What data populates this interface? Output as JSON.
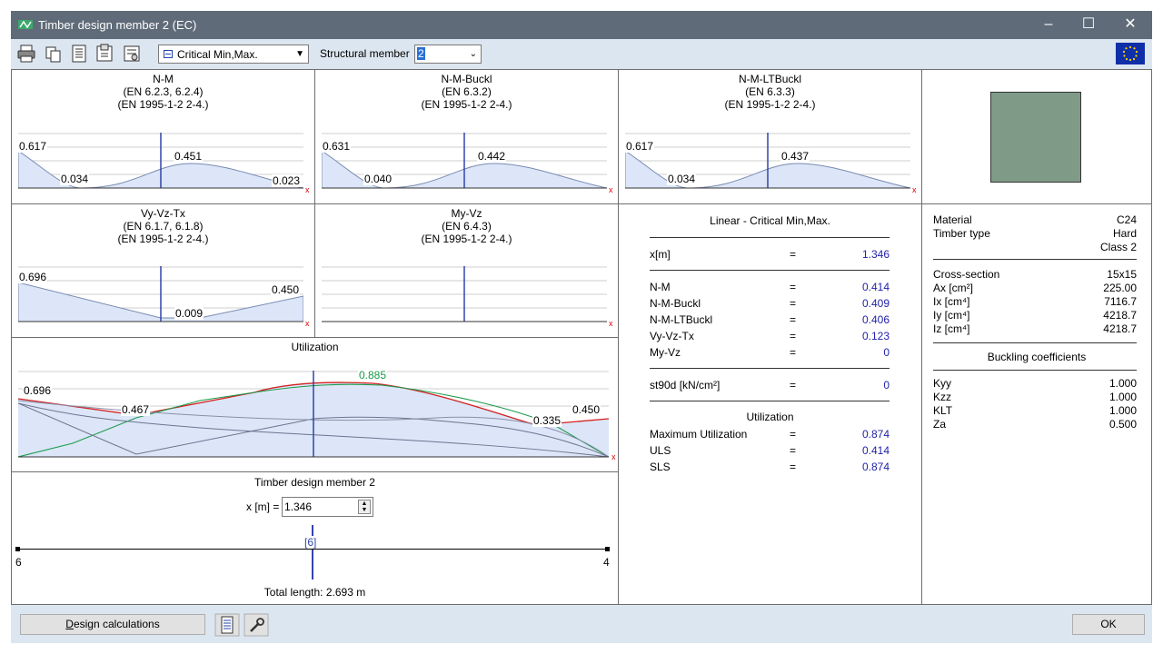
{
  "window": {
    "title": "Timber design member 2 (EC)",
    "controls": {
      "minimize": "–",
      "maximize": "☐",
      "close": "✕"
    }
  },
  "toolbar": {
    "icons": [
      "printer-icon",
      "copy-icon",
      "report-icon",
      "export-icon",
      "settings-icon"
    ],
    "mode_select": {
      "value": "Critical Min,Max."
    },
    "member_label": "Structural member",
    "member_select": {
      "value": "2"
    },
    "flag_icon": "eu-flag-icon"
  },
  "panels": {
    "nm": {
      "title": "N-M",
      "ref1": "(EN 6.2.3, 6.2.4)",
      "ref2": "(EN 1995-1-2 2-4.)",
      "labels": [
        "0.617",
        "0.034",
        "0.451",
        "0.023"
      ],
      "axis_x": "x"
    },
    "nm_buckl": {
      "title": "N-M-Buckl",
      "ref1": "(EN 6.3.2)",
      "ref2": "(EN 1995-1-2 2-4.)",
      "labels": [
        "0.631",
        "0.040",
        "0.442"
      ],
      "axis_x": "x"
    },
    "nm_ltbuckl": {
      "title": "N-M-LTBuckl",
      "ref1": "(EN 6.3.3)",
      "ref2": "(EN 1995-1-2 2-4.)",
      "labels": [
        "0.617",
        "0.034",
        "0.437"
      ],
      "axis_x": "x"
    },
    "vyvztx": {
      "title": "Vy-Vz-Tx",
      "ref1": "(EN 6.1.7, 6.1.8)",
      "ref2": "(EN 1995-1-2 2-4.)",
      "labels": [
        "0.696",
        "0.009",
        "0.450"
      ],
      "axis_x": "x"
    },
    "myvz": {
      "title": "My-Vz",
      "ref1": "(EN 6.4.3)",
      "ref2": "(EN 1995-1-2 2-4.)",
      "axis_x": "x"
    },
    "utilization": {
      "title": "Utilization",
      "labels": [
        "0.696",
        "0.467",
        "0.885",
        "0.335",
        "0.450"
      ],
      "axis_x": "x",
      "colors": {
        "max": "#d42020",
        "green": "#1a9a4a",
        "grey": "#6c7390",
        "fill": "#dce6f8"
      }
    }
  },
  "member": {
    "title": "Timber design member 2",
    "x_label": "x [m] =",
    "x_value": "1.346",
    "node_left": "6",
    "node_right": "4",
    "marker": "[6]",
    "total_length": "Total length: 2.693 m"
  },
  "results": {
    "title": "Linear - Critical Min,Max.",
    "x_row": {
      "label": "x[m]",
      "eq": "=",
      "value": "1.346"
    },
    "rows": [
      {
        "label": "N-M",
        "eq": "=",
        "value": "0.414"
      },
      {
        "label": "N-M-Buckl",
        "eq": "=",
        "value": "0.409"
      },
      {
        "label": "N-M-LTBuckl",
        "eq": "=",
        "value": "0.406"
      },
      {
        "label": "Vy-Vz-Tx",
        "eq": "=",
        "value": "0.123"
      },
      {
        "label": "My-Vz",
        "eq": "=",
        "value": "0"
      }
    ],
    "st90d": {
      "label": "st90d [kN/cm²]",
      "eq": "=",
      "value": "0"
    },
    "util_title": "Utilization",
    "util_rows": [
      {
        "label": "Maximum Utilization",
        "eq": "=",
        "value": "0.874"
      },
      {
        "label": "ULS",
        "eq": "=",
        "value": "0.414"
      },
      {
        "label": "SLS",
        "eq": "=",
        "value": "0.874"
      }
    ]
  },
  "properties": {
    "section_color": "#7f9b88",
    "material_label": "Material",
    "material_value": "C24",
    "timber_type_label": "Timber type",
    "timber_type_value": "Hard",
    "class_value": "Class 2",
    "cross_section": [
      {
        "label": "Cross-section",
        "value": "15x15"
      },
      {
        "label": "Ax [cm²]",
        "value": "225.00"
      },
      {
        "label": "Ix [cm⁴]",
        "value": "7116.7"
      },
      {
        "label": "Iy [cm⁴]",
        "value": "4218.7"
      },
      {
        "label": "Iz [cm⁴]",
        "value": "4218.7"
      }
    ],
    "buckling_title": "Buckling coefficients",
    "buckling": [
      {
        "label": "Kyy",
        "value": "1.000"
      },
      {
        "label": "Kzz",
        "value": "1.000"
      },
      {
        "label": "KLT",
        "value": "1.000"
      },
      {
        "label": "Za",
        "value": "0.500"
      }
    ]
  },
  "footer": {
    "design_button": "Design calculations",
    "ok_button": "OK",
    "icons": [
      "report-icon",
      "wrench-icon"
    ]
  }
}
